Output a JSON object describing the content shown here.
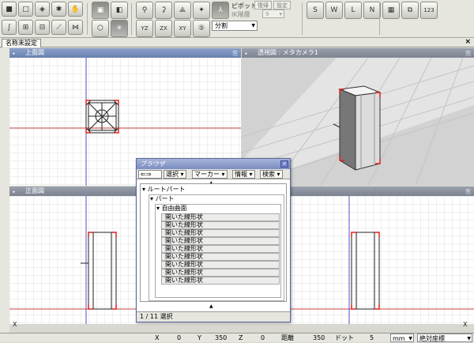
{
  "toolbar": {
    "pivot_label": "ピボット",
    "ik_label": "IK階層",
    "ik_value": "9",
    "restore_label": "復帰",
    "settings_label": "設定",
    "split_value": "分割",
    "badge_123": "123"
  },
  "tab": {
    "label": "名称未設定",
    "close": "×"
  },
  "views": {
    "top": {
      "title": "上面図"
    },
    "perspective": {
      "title": "透視図 : メタカメラ1"
    },
    "front": {
      "title": "正面図"
    }
  },
  "axis_labels": {
    "z_top": "Z",
    "x_top": "X",
    "y_front": "Y",
    "x_front": "X",
    "z_persp": "Z",
    "x_right": "X"
  },
  "browser": {
    "title": "ブラウザ",
    "close": "×",
    "toolbar": {
      "select": "選択",
      "marker": "マーカー",
      "info": "情報",
      "search": "検索"
    },
    "tree": {
      "root": "ルートパート",
      "part": "パート",
      "surface": "自由曲面",
      "items": [
        "開いた線形状",
        "開いた線形状",
        "開いた線形状",
        "開いた線形状",
        "開いた線形状",
        "開いた線形状",
        "開いた線形状",
        "開いた線形状",
        "開いた線形状"
      ]
    },
    "status": "1 / 11 選択"
  },
  "statusbar": {
    "x_label": "X",
    "x_value": "0",
    "y_label": "Y",
    "y_value": "350",
    "z_label": "Z",
    "z_value": "0",
    "distance_label": "距離",
    "distance_value": "350",
    "dot_label": "ドット",
    "dot_value": "5",
    "unit": "mm",
    "coord_mode": "絶対座標"
  },
  "colors": {
    "viewport_bg": "#ffffff",
    "grid": "#d8d8d8",
    "axis_x": "#d04040",
    "axis_y": "#4040d0",
    "header_active": "#6780b0",
    "header": "#7c8290"
  }
}
